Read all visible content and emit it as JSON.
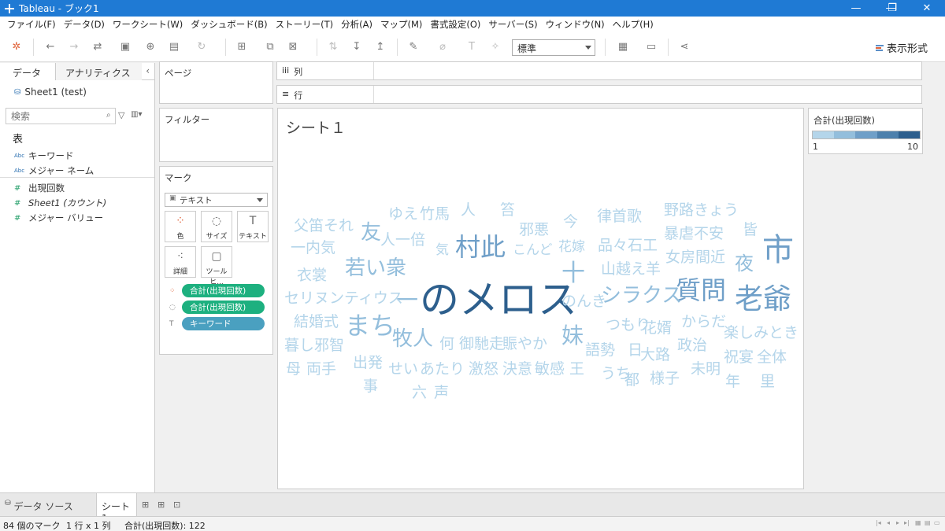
{
  "window": {
    "title": "Tableau - ブック1",
    "minimize": "—",
    "restore": "❐",
    "close": "✕"
  },
  "menu": [
    "ファイル(F)",
    "データ(D)",
    "ワークシート(W)",
    "ダッシュボード(B)",
    "ストーリー(T)",
    "分析(A)",
    "マップ(M)",
    "書式設定(O)",
    "サーバー(S)",
    "ウィンドウ(N)",
    "ヘルプ(H)"
  ],
  "toolbar": {
    "fit_select": "標準",
    "show_me": "表示形式"
  },
  "data_pane": {
    "tabs": {
      "data": "データ",
      "analytics": "アナリティクス"
    },
    "collapse": "‹",
    "datasource": "Sheet1 (test)",
    "search_placeholder": "検索",
    "section": "表",
    "dimensions": [
      {
        "type": "Abc",
        "label": "キーワード"
      },
      {
        "type": "Abc",
        "label": "メジャー ネーム"
      }
    ],
    "measures": [
      {
        "type": "#",
        "label": "出現回数"
      },
      {
        "type": "#",
        "label": "Sheet1 (カウント)"
      },
      {
        "type": "#",
        "label": "メジャー バリュー"
      }
    ]
  },
  "shelves": {
    "pages": "ページ",
    "filters": "フィルター",
    "columns": "列",
    "rows": "行",
    "columns_icon": "iii",
    "rows_icon": "≡"
  },
  "marks": {
    "title": "マーク",
    "type": "テキスト",
    "buttons": {
      "color": "色",
      "size": "サイズ",
      "text": "テキスト",
      "detail": "詳細",
      "tooltip": "ツールヒ..."
    },
    "pills": [
      {
        "label": "合計(出現回数)",
        "role": "color"
      },
      {
        "label": "合計(出現回数)",
        "role": "size"
      },
      {
        "label": "キーワード",
        "role": "text"
      }
    ]
  },
  "sheet": {
    "title": "シート１"
  },
  "colors": {
    "c1": "#b4d5ea",
    "c2": "#93bedc",
    "c3": "#6f9fc8",
    "c4": "#4d80ac",
    "c5": "#2d5f8d"
  },
  "chart_data": {
    "type": "word_cloud",
    "measure": "合計(出現回数)",
    "range": [
      1,
      10
    ],
    "words": [
      {
        "text": "のメロス",
        "value": 10
      },
      {
        "text": "市",
        "value": 6
      },
      {
        "text": "老爺",
        "value": 5
      },
      {
        "text": "村此",
        "value": 5
      },
      {
        "text": "質問",
        "value": 5
      },
      {
        "text": "まち",
        "value": 4
      },
      {
        "text": "十",
        "value": 4
      },
      {
        "text": "一",
        "value": 4
      },
      {
        "text": "若い衆",
        "value": 3
      },
      {
        "text": "牧人",
        "value": 3
      },
      {
        "text": "妹",
        "value": 3
      },
      {
        "text": "友",
        "value": 3
      },
      {
        "text": "シラクス",
        "value": 3
      },
      {
        "text": "夜",
        "value": 3
      },
      {
        "text": "父笛それ",
        "value": 1
      },
      {
        "text": "ゆえ",
        "value": 1
      },
      {
        "text": "竹馬",
        "value": 1
      },
      {
        "text": "人",
        "value": 1
      },
      {
        "text": "笞",
        "value": 1
      },
      {
        "text": "今",
        "value": 1
      },
      {
        "text": "律首歌",
        "value": 1
      },
      {
        "text": "野路きょう",
        "value": 1
      },
      {
        "text": "邪悪",
        "value": 1
      },
      {
        "text": "暴虐不安",
        "value": 1
      },
      {
        "text": "皆",
        "value": 1
      },
      {
        "text": "人一倍",
        "value": 1
      },
      {
        "text": "一内気",
        "value": 1
      },
      {
        "text": "気",
        "value": 1
      },
      {
        "text": "こんど",
        "value": 1
      },
      {
        "text": "花嫁",
        "value": 1
      },
      {
        "text": "品々石工",
        "value": 1
      },
      {
        "text": "女房間近",
        "value": 1
      },
      {
        "text": "衣裳",
        "value": 1
      },
      {
        "text": "山越え羊",
        "value": 1
      },
      {
        "text": "のんき",
        "value": 1
      },
      {
        "text": "セリヌンティウス",
        "value": 1
      },
      {
        "text": "結婚式",
        "value": 1
      },
      {
        "text": "つもり",
        "value": 1
      },
      {
        "text": "花婿",
        "value": 1
      },
      {
        "text": "からだ",
        "value": 1
      },
      {
        "text": "楽しみとき",
        "value": 1
      },
      {
        "text": "暮し邪智",
        "value": 1
      },
      {
        "text": "何",
        "value": 1
      },
      {
        "text": "御馳走",
        "value": 1
      },
      {
        "text": "賑やか",
        "value": 1
      },
      {
        "text": "語勢",
        "value": 1
      },
      {
        "text": "日",
        "value": 1
      },
      {
        "text": "大路",
        "value": 1
      },
      {
        "text": "政治",
        "value": 1
      },
      {
        "text": "祝宴",
        "value": 1
      },
      {
        "text": "全体",
        "value": 1
      },
      {
        "text": "母",
        "value": 1
      },
      {
        "text": "両手",
        "value": 1
      },
      {
        "text": "出発",
        "value": 1
      },
      {
        "text": "せい",
        "value": 1
      },
      {
        "text": "あたり",
        "value": 1
      },
      {
        "text": "激怒",
        "value": 1
      },
      {
        "text": "決意",
        "value": 1
      },
      {
        "text": "敏感",
        "value": 1
      },
      {
        "text": "王",
        "value": 1
      },
      {
        "text": "うち",
        "value": 1
      },
      {
        "text": "都",
        "value": 1
      },
      {
        "text": "様子",
        "value": 1
      },
      {
        "text": "未明",
        "value": 1
      },
      {
        "text": "年",
        "value": 1
      },
      {
        "text": "里",
        "value": 1
      },
      {
        "text": "事",
        "value": 1
      },
      {
        "text": "六",
        "value": 1
      },
      {
        "text": "声",
        "value": 1
      }
    ]
  },
  "legend": {
    "title": "合計(出現回数)",
    "min": "1",
    "max": "10"
  },
  "sheet_tabs": {
    "datasource": "データ ソース",
    "sheet": "シート 1"
  },
  "status": {
    "marks": "84 個のマーク",
    "grid": "1 行 x 1 列",
    "sum": "合計(出現回数): 122"
  }
}
